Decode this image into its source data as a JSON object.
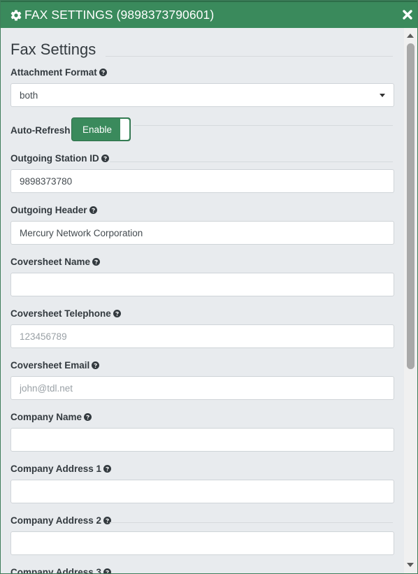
{
  "dialog": {
    "title": "FAX SETTINGS (9898373790601)",
    "close_icon": "close-x-icon",
    "title_icon": "gear-icon"
  },
  "heading": "Fax Settings",
  "attachment_format": {
    "label": "Attachment Format",
    "value": "both"
  },
  "auto_refresh": {
    "label": "Auto-Refresh",
    "toggle_label": "Enable",
    "state": "on"
  },
  "outgoing_station_id": {
    "label": "Outgoing Station ID",
    "value": "9898373780"
  },
  "outgoing_header": {
    "label": "Outgoing Header",
    "value": "Mercury Network Corporation"
  },
  "coversheet_name": {
    "label": "Coversheet Name",
    "value": ""
  },
  "coversheet_telephone": {
    "label": "Coversheet Telephone",
    "placeholder": "123456789"
  },
  "coversheet_email": {
    "label": "Coversheet Email",
    "placeholder": "john@tdl.net"
  },
  "company_name": {
    "label": "Company Name",
    "value": ""
  },
  "company_address_1": {
    "label": "Company Address 1",
    "value": ""
  },
  "company_address_2": {
    "label": "Company Address 2",
    "value": ""
  },
  "company_address_3": {
    "label": "Company Address 3"
  },
  "colors": {
    "accent": "#3a8a5c",
    "background": "#e8ebee"
  }
}
